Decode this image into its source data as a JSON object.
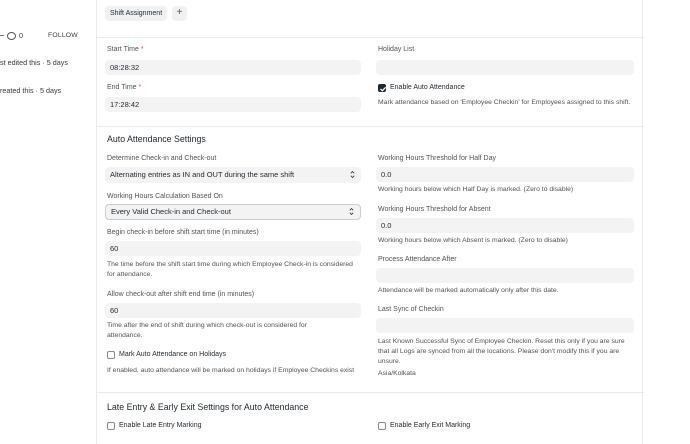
{
  "sidebar": {
    "comment_count": "0",
    "follow_label": "FOLLOW",
    "edited_text": "st edited this · 5 days",
    "created_text": "reated this · 5 days"
  },
  "tabs": {
    "items": [
      {
        "label": "Shift Assignment"
      }
    ],
    "add_label": "+"
  },
  "form": {
    "start_time": {
      "label": "Start Time",
      "required": "*",
      "value": "08:28:32"
    },
    "end_time": {
      "label": "End Time",
      "required": "*",
      "value": "17:28:42"
    },
    "holiday_list": {
      "label": "Holiday List",
      "value": ""
    },
    "enable_auto_attendance": {
      "label": "Enable Auto Attendance",
      "checked": true,
      "description": "Mark attendance based on 'Employee Checkin' for Employees assigned to this shift."
    }
  },
  "auto_attendance": {
    "title": "Auto Attendance Settings",
    "determine": {
      "label": "Determine Check-in and Check-out",
      "value": "Alternating entries as IN and OUT during the same shift"
    },
    "calc_based_on": {
      "label": "Working Hours Calculation Based On",
      "value": "Every Valid Check-in and Check-out"
    },
    "begin_checkin": {
      "label": "Begin check-in before shift start time (in minutes)",
      "value": "60",
      "description": "The time before the shift start time during which Employee Check-in is considered for attendance."
    },
    "allow_checkout": {
      "label": "Allow check-out after shift end time (in minutes)",
      "value": "60",
      "description": "Time after the end of shift during which check-out is considered for attendance."
    },
    "mark_holidays": {
      "label": "Mark Auto Attendance on Holidays",
      "checked": false,
      "description": "If enabled, auto attendance will be marked on holidays if Employee Checkins exist"
    },
    "half_day_threshold": {
      "label": "Working Hours Threshold for Half Day",
      "value": "0.0",
      "description": "Working hours below which Half Day is marked. (Zero to disable)"
    },
    "absent_threshold": {
      "label": "Working Hours Threshold for Absent",
      "value": "0.0",
      "description": "Working hours below which Absent is marked. (Zero to disable)"
    },
    "process_after": {
      "label": "Process Attendance After",
      "value": "",
      "description": "Attendance will be marked automatically only after this date."
    },
    "last_sync": {
      "label": "Last Sync of Checkin",
      "value": "",
      "description": "Last Known Successful Sync of Employee Checkin. Reset this only if you are sure that all Logs are synced from all the locations. Please don't modify this if you are unsure.",
      "timezone": "Asia/Kolkata"
    }
  },
  "late_entry": {
    "title": "Late Entry & Early Exit Settings for Auto Attendance",
    "enable_late": {
      "label": "Enable Late Entry Marking",
      "checked": false
    },
    "enable_early": {
      "label": "Enable Early Exit Marking",
      "checked": false
    }
  }
}
